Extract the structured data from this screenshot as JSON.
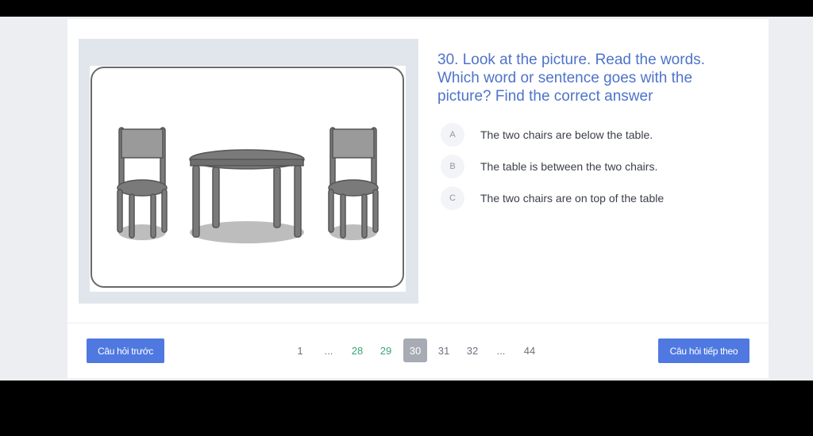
{
  "question": {
    "text": "30. Look at the picture. Read the words. Which word or sentence goes with the picture? Find the correct answer"
  },
  "options": [
    {
      "letter": "A",
      "text": "The two chairs are below the table."
    },
    {
      "letter": "B",
      "text": "The table is between the two chairs."
    },
    {
      "letter": "C",
      "text": "The two chairs are on top of the table"
    }
  ],
  "navigation": {
    "prev_label": "Câu hỏi trước",
    "next_label": "Câu hỏi tiếp theo"
  },
  "pagination": {
    "pages": [
      "1",
      "...",
      "28",
      "29",
      "30",
      "31",
      "32",
      "...",
      "44"
    ],
    "current": "30"
  },
  "colors": {
    "accent": "#4f79e0",
    "question": "#4e73c9",
    "answered_page": "#3aa675",
    "current_page_bg": "#a7abb4"
  }
}
